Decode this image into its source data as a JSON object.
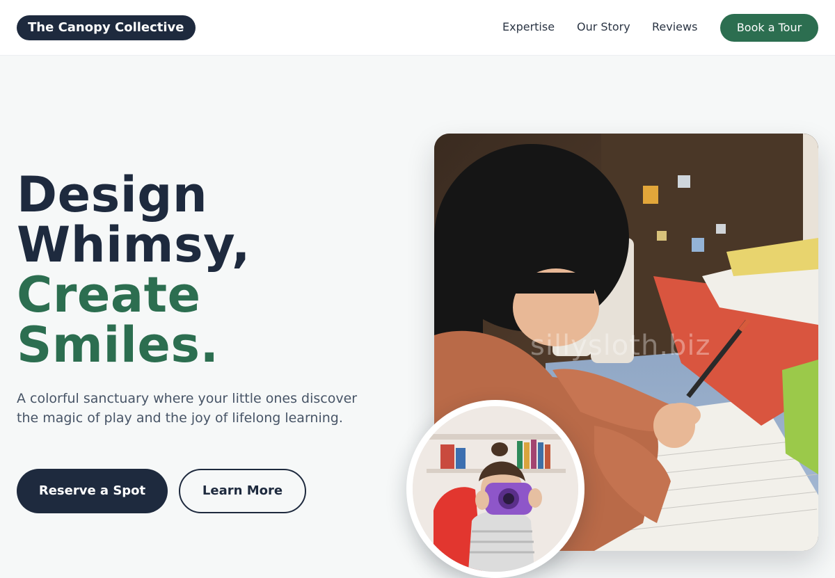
{
  "header": {
    "brand": "The Canopy Collective",
    "nav": [
      "Expertise",
      "Our Story",
      "Reviews"
    ],
    "cta": "Book a Tour"
  },
  "hero": {
    "title_lines_dark": [
      "Design",
      "Whimsy,"
    ],
    "title_lines_green": [
      "Create",
      "Smiles."
    ],
    "subtitle": "A colorful sanctuary where your little ones discover the magic of play and the joy of lifelong learning.",
    "primary_button": "Reserve a Spot",
    "secondary_button": "Learn More"
  },
  "images": {
    "main_watermark": "sillysloth.biz"
  },
  "colors": {
    "navy": "#1e2a3e",
    "green": "#2c6e50",
    "background": "#f6f8f8"
  }
}
